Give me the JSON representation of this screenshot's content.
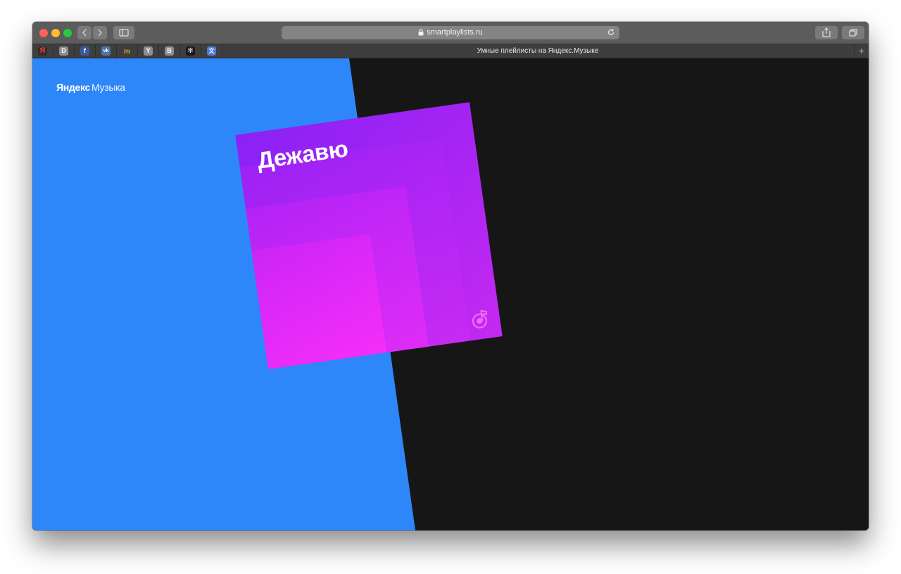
{
  "browser": {
    "url": "smartplaylists.ru",
    "tab_title": "Умные плейлисты на Яндекс.Музыке",
    "new_tab": "+"
  },
  "favorites": [
    {
      "icon": "yandex-icon",
      "glyph": "Я",
      "color": "#2e2e2e",
      "text_color": "#ff3b30"
    },
    {
      "icon": "d-icon",
      "glyph": "D",
      "color": "#8e8e8e",
      "text_color": "#ffffff"
    },
    {
      "icon": "facebook-icon",
      "glyph": "f",
      "color": "#3b5998",
      "text_color": "#ffffff"
    },
    {
      "icon": "vk-icon",
      "glyph": "vk",
      "color": "#4a76a8",
      "text_color": "#ffffff"
    },
    {
      "icon": "m-icon",
      "glyph": "m",
      "color": "#3e3e3e",
      "text_color": "#c79a3a"
    },
    {
      "icon": "y-icon",
      "glyph": "Y",
      "color": "#8e8e8e",
      "text_color": "#ffffff"
    },
    {
      "icon": "b-icon",
      "glyph": "B",
      "color": "#8e8e8e",
      "text_color": "#ffffff"
    },
    {
      "icon": "pattern-icon",
      "glyph": "✻",
      "color": "#1a1a1a",
      "text_color": "#dddddd"
    },
    {
      "icon": "translate-icon",
      "glyph": "文",
      "color": "#4a7bd8",
      "text_color": "#ffffff"
    }
  ],
  "page": {
    "logo_bold": "Яндекс",
    "logo_light": "Музыка",
    "cover_title": "Дежавю",
    "colors": {
      "blue": "#2e87f8",
      "dark": "#161616",
      "purple": "#8a22f5",
      "magenta": "#f52ef9"
    }
  }
}
